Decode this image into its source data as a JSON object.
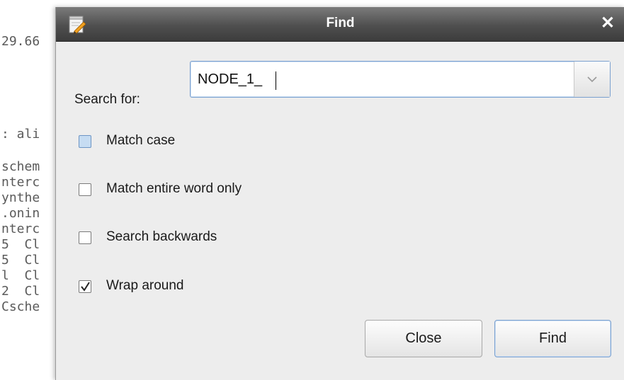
{
  "background_editor": {
    "lines": [
      "29.66",
      "",
      "",
      ": ali",
      "",
      "schem",
      "nterc",
      "ynthe",
      ".onin",
      "nterc",
      "5  Cl",
      "5  Cl",
      "l  Cl",
      "2  Cl",
      "Csche"
    ]
  },
  "dialog": {
    "title": "Find",
    "icon": "notepad-pencil-icon",
    "close_icon": "close-x-icon",
    "search": {
      "label": "Search for:",
      "value": "NODE_1_",
      "dropdown_icon": "chevron-down-icon"
    },
    "options": [
      {
        "label": "Match case",
        "checked": false,
        "focused": true
      },
      {
        "label": "Match entire word only",
        "checked": false,
        "focused": false
      },
      {
        "label": "Search backwards",
        "checked": false,
        "focused": false
      },
      {
        "label": "Wrap around",
        "checked": true,
        "focused": false
      }
    ],
    "buttons": {
      "close_label": "Close",
      "find_label": "Find"
    }
  },
  "colors": {
    "titlebar": "#4f4f4f",
    "dialog_bg": "#ededed",
    "focus_accent": "#7aa0cf"
  }
}
